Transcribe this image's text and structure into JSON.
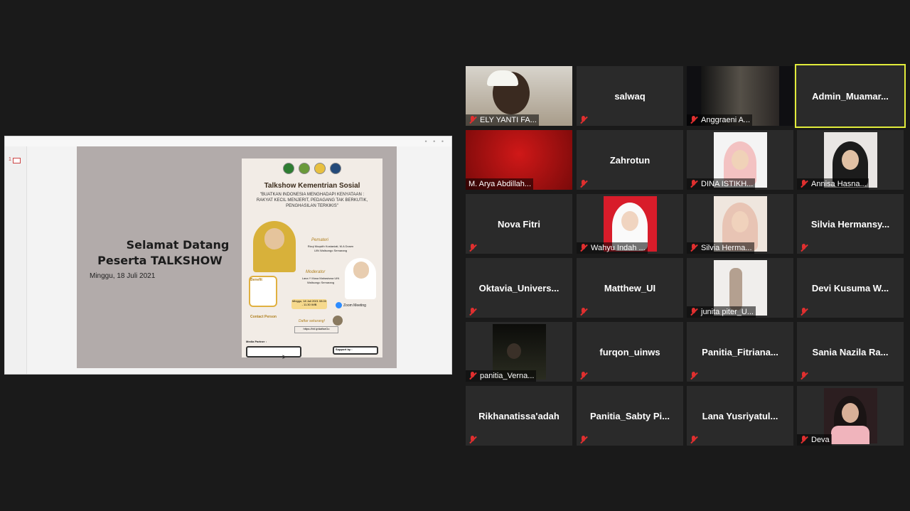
{
  "shared_screen": {
    "slide_number": "1",
    "welcome_line1": "Selamat Datang",
    "welcome_line2": "Peserta TALKSHOW",
    "date": "Minggu, 18 Juli 2021",
    "poster": {
      "title": "Talkshow Kementrian Sosial",
      "subtitle": "\"BUATKAN INDONESIA MENGHADAPI KENYATAAN : RAKYAT KECIL MENJERIT, PEDAGANG TAK BERKUTIK, PENGHASILAN TERKIKIS\"",
      "speaker_label": "Pemateri",
      "speaker_text": "Rizqi Muqsith Kostaniati, M.A Dosen UIN Walisongo Semarang",
      "moderator_label": "Moderator",
      "moderator_text": "Lana Y Musa Mahasiswa UIN Walisongo Semarang",
      "benefit_label": "Benefit",
      "event_date": "Minggu, 18 Juli 2021 08.00 - 11.30 WIB",
      "zoom_label": "Zoom Meeting",
      "contact_label": "Contact Person",
      "register_label": "Daftar sekarang!",
      "register_link": "https://bit.ly/daftarGo",
      "media_partner_label": "Media Partner :",
      "support_label": "Support by :"
    }
  },
  "participants": [
    {
      "name": "ELY YANTI FA...",
      "type": "video",
      "muted": true
    },
    {
      "name": "salwaq",
      "type": "name",
      "muted": true
    },
    {
      "name": "Anggraeni A...",
      "type": "video",
      "muted": true
    },
    {
      "name": "Admin_Muamar...",
      "type": "name",
      "muted": false,
      "active": true
    },
    {
      "name": "M. Arya Abdillah...",
      "type": "video",
      "muted": false
    },
    {
      "name": "Zahrotun",
      "type": "name",
      "muted": true
    },
    {
      "name": "DINA ISTIKH...",
      "type": "video",
      "muted": true
    },
    {
      "name": "Annisa Hasna...",
      "type": "video",
      "muted": true
    },
    {
      "name": "Nova Fitri",
      "type": "name",
      "muted": true
    },
    {
      "name": "Wahyu Indah ...",
      "type": "video",
      "muted": true
    },
    {
      "name": "Silvia Herma...",
      "type": "video",
      "muted": true
    },
    {
      "name": "Silvia  Hermansy...",
      "type": "name",
      "muted": true
    },
    {
      "name": "Oktavia_Univers...",
      "type": "name",
      "muted": true
    },
    {
      "name": "Matthew_UI",
      "type": "name",
      "muted": true
    },
    {
      "name": "junita piter_U...",
      "type": "video",
      "muted": true
    },
    {
      "name": "Devi Kusuma W...",
      "type": "name",
      "muted": true
    },
    {
      "name": "panitia_Verna...",
      "type": "video",
      "muted": true
    },
    {
      "name": "furqon_uinws",
      "type": "name",
      "muted": true
    },
    {
      "name": "Panitia_Fitriana...",
      "type": "name",
      "muted": true
    },
    {
      "name": "Sania  Nazila Ra...",
      "type": "name",
      "muted": true
    },
    {
      "name": "Rikhanatissa'adah",
      "type": "name",
      "muted": true
    },
    {
      "name": "Panitia_Sabty  Pi...",
      "type": "name",
      "muted": true
    },
    {
      "name": "Lana  Yusriyatul...",
      "type": "name",
      "muted": true
    },
    {
      "name": "Deva",
      "type": "video",
      "muted": true
    }
  ],
  "colors": {
    "background": "#1a1a1a",
    "tile": "#2a2a2a",
    "active_border": "#e2ec3b",
    "muted_icon": "#e02f2f"
  }
}
